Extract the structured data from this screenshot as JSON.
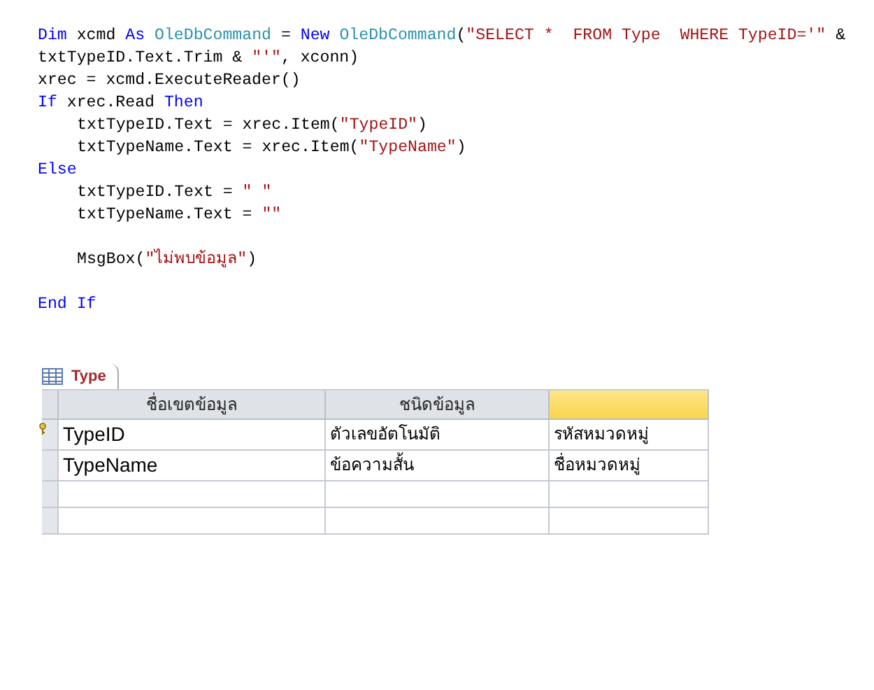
{
  "code": {
    "lines": [
      {
        "kind": "code",
        "indented": false,
        "tokens": [
          {
            "kind": "kw",
            "text": "Dim"
          },
          {
            "kind": "plain",
            "text": " xcmd "
          },
          {
            "kind": "kw",
            "text": "As"
          },
          {
            "kind": "type",
            "text": " OleDbCommand"
          },
          {
            "kind": "plain",
            "text": " = "
          },
          {
            "kind": "kw",
            "text": "New"
          },
          {
            "kind": "type",
            "text": " OleDbCommand"
          },
          {
            "kind": "plain",
            "text": "("
          },
          {
            "kind": "str",
            "text": "\"SELECT *  FROM Type  WHERE TypeID='\""
          },
          {
            "kind": "plain",
            "text": " &"
          }
        ]
      },
      {
        "kind": "code",
        "indented": false,
        "tokens": [
          {
            "kind": "plain",
            "text": "txtTypeID.Text.Trim & "
          },
          {
            "kind": "str",
            "text": "\"'\""
          },
          {
            "kind": "plain",
            "text": ", xconn)"
          }
        ]
      },
      {
        "kind": "code",
        "indented": false,
        "tokens": [
          {
            "kind": "plain",
            "text": "xrec = xcmd.ExecuteReader()"
          }
        ]
      },
      {
        "kind": "code",
        "indented": false,
        "tokens": [
          {
            "kind": "kw",
            "text": "If"
          },
          {
            "kind": "plain",
            "text": " xrec.Read "
          },
          {
            "kind": "kw",
            "text": "Then"
          }
        ]
      },
      {
        "kind": "code",
        "indented": true,
        "tokens": [
          {
            "kind": "plain",
            "text": "txtTypeID.Text = xrec.Item("
          },
          {
            "kind": "str",
            "text": "\"TypeID\""
          },
          {
            "kind": "plain",
            "text": ")"
          }
        ]
      },
      {
        "kind": "code",
        "indented": true,
        "tokens": [
          {
            "kind": "plain",
            "text": "txtTypeName.Text = xrec.Item("
          },
          {
            "kind": "str",
            "text": "\"TypeName\""
          },
          {
            "kind": "plain",
            "text": ")"
          }
        ]
      },
      {
        "kind": "code",
        "indented": false,
        "tokens": [
          {
            "kind": "kw",
            "text": "Else"
          }
        ]
      },
      {
        "kind": "code",
        "indented": true,
        "tokens": [
          {
            "kind": "plain",
            "text": "txtTypeID.Text = "
          },
          {
            "kind": "str",
            "text": "\" \""
          }
        ]
      },
      {
        "kind": "code",
        "indented": true,
        "tokens": [
          {
            "kind": "plain",
            "text": "txtTypeName.Text = "
          },
          {
            "kind": "str",
            "text": "\"\""
          }
        ]
      },
      {
        "kind": "blank"
      },
      {
        "kind": "code",
        "indented": true,
        "tokens": [
          {
            "kind": "plain",
            "text": "MsgBox("
          },
          {
            "kind": "str",
            "text": "\"ไม่พบข้อมูล\""
          },
          {
            "kind": "plain",
            "text": ")"
          }
        ]
      },
      {
        "kind": "blank"
      },
      {
        "kind": "code",
        "indented": false,
        "tokens": [
          {
            "kind": "kw",
            "text": "End"
          },
          {
            "kind": "kw",
            "text": " If"
          }
        ]
      }
    ]
  },
  "table": {
    "tab": {
      "label": "Type"
    },
    "columns": [
      {
        "label": "ชื่อเขตข้อมูล",
        "selected": false
      },
      {
        "label": "ชนิดข้อมูล",
        "selected": false
      },
      {
        "selected": true
      }
    ],
    "rows": [
      {
        "primary_key": true,
        "cells": [
          "TypeID",
          "ตัวเลขอัตโนมัติ",
          "รหัสหมวดหมู่"
        ]
      },
      {
        "primary_key": false,
        "cells": [
          "TypeName",
          "ข้อความสั้น",
          "ชื่อหมวดหมู่"
        ]
      }
    ]
  }
}
